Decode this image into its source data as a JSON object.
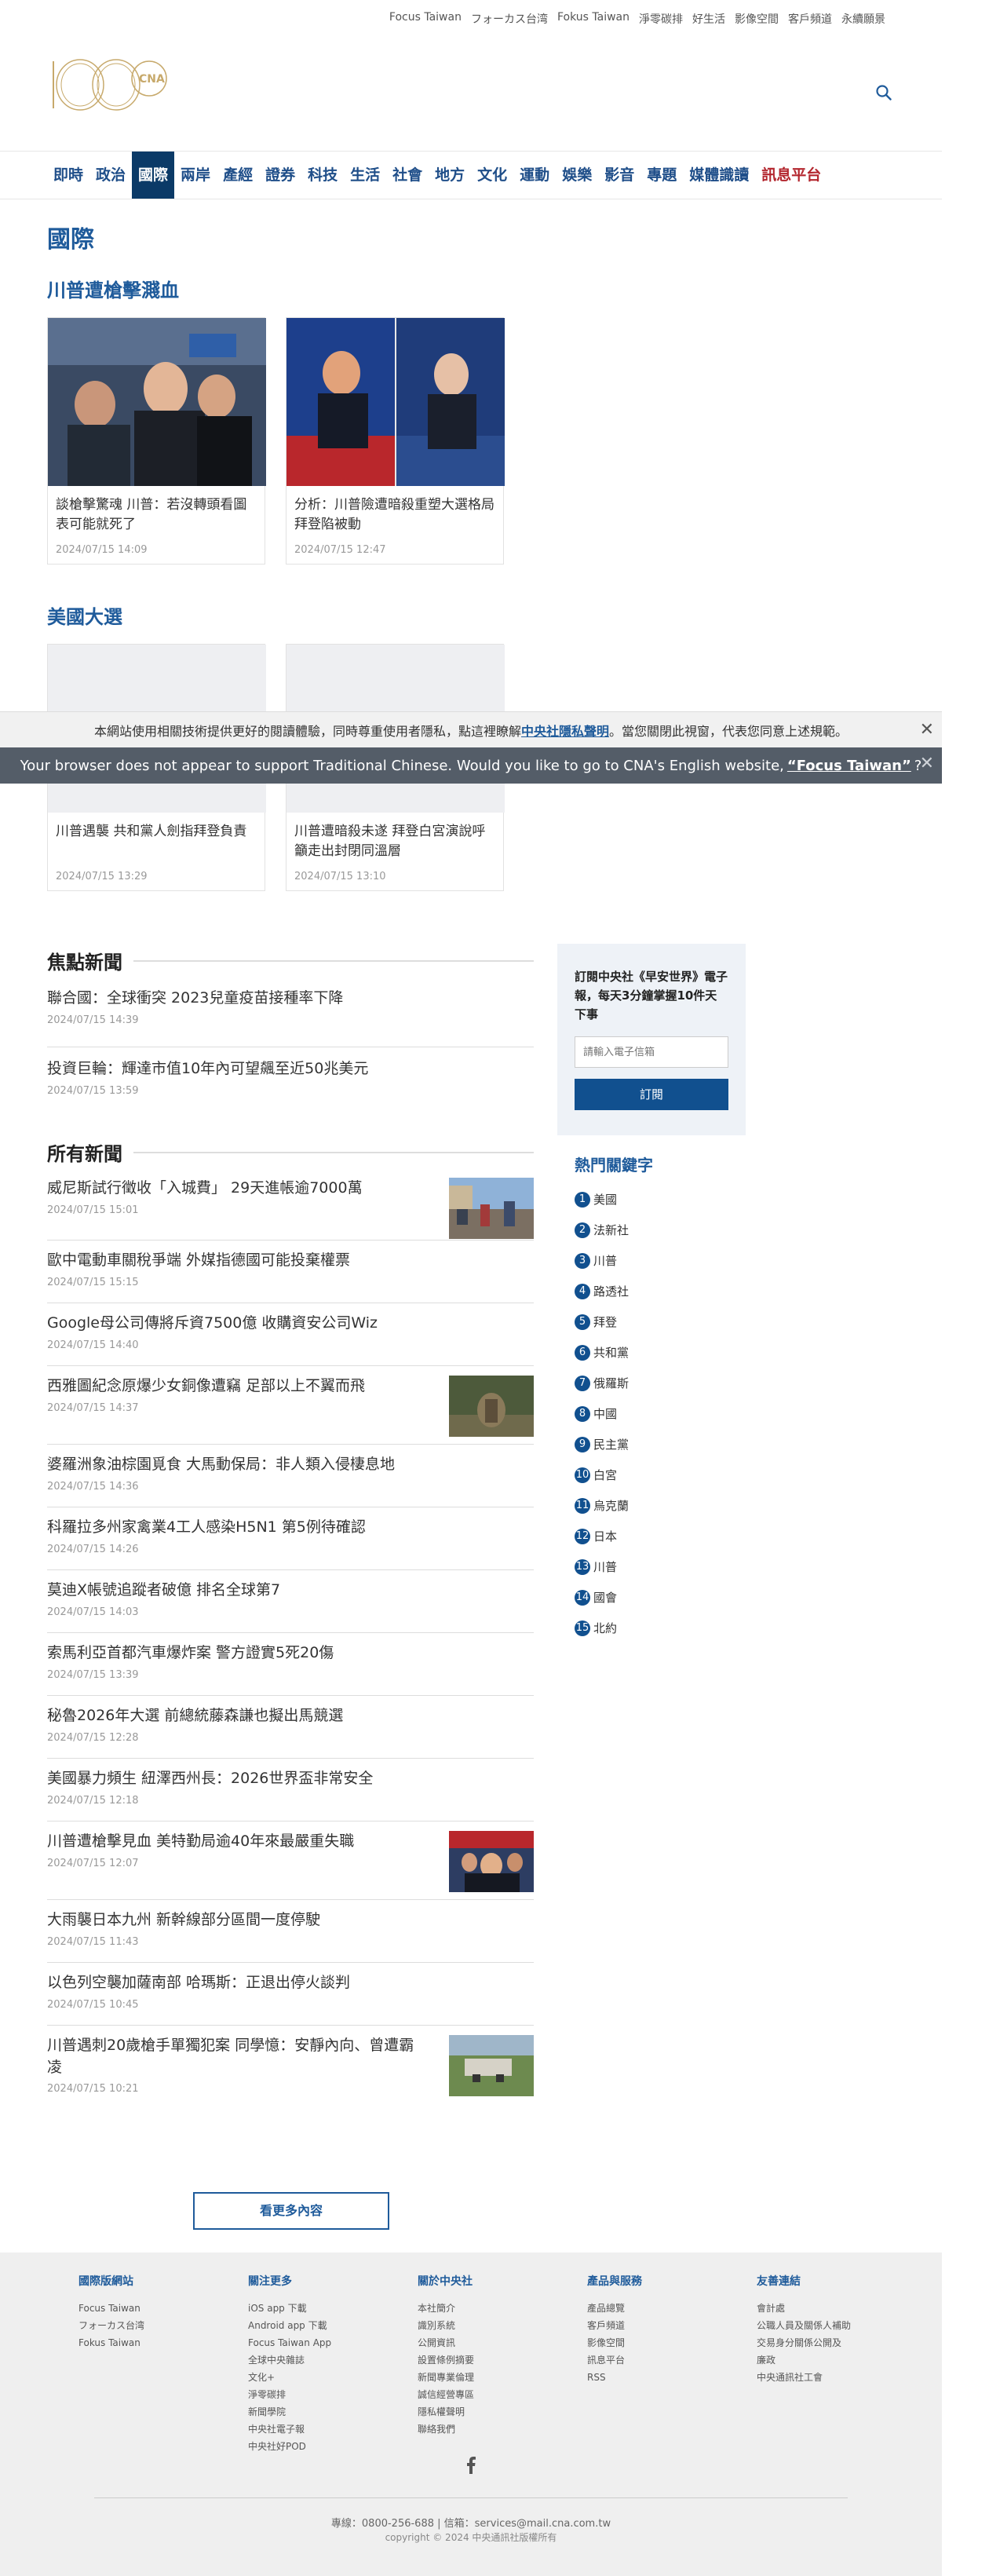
{
  "utility_links": [
    "Focus Taiwan",
    "フォーカス台湾",
    "Fokus Taiwan",
    "淨零碳排",
    "好生活",
    "影像空間",
    "客戶頻道",
    "永續願景"
  ],
  "nav": [
    "即時",
    "政治",
    "國際",
    "兩岸",
    "產經",
    "證券",
    "科技",
    "生活",
    "社會",
    "地方",
    "文化",
    "運動",
    "娛樂",
    "影音",
    "專題",
    "媒體識讀",
    "訊息平台"
  ],
  "page_title": "國際",
  "section1": {
    "title": "川普遭槍擊濺血",
    "cards": [
      {
        "title": "談槍擊驚魂 川普：若沒轉頭看圖表可能就死了",
        "date": "2024/07/15 14:09"
      },
      {
        "title": "分析：川普險遭暗殺重塑大選格局 拜登陷被動",
        "date": "2024/07/15 12:47"
      }
    ]
  },
  "section2": {
    "title": "美國大選",
    "cards": [
      {
        "title": "川普遇襲 共和黨人劍指拜登負責",
        "date": "2024/07/15 13:29"
      },
      {
        "title": "川普遭暗殺未遂 拜登白宮演說呼籲走出封閉同溫層",
        "date": "2024/07/15 13:10"
      }
    ]
  },
  "cookie": {
    "text_before": "本網站使用相關技術提供更好的閱讀體驗，同時尊重使用者隱私，點這裡瞭解",
    "link": "中央社隱私聲明",
    "text_after": "。當您關閉此視窗，代表您同意上述規範。",
    "close": "✕"
  },
  "lang_banner": {
    "text_before": "Your browser does not appear to support Traditional Chinese. Would you like to go to CNA's English website,",
    "link": "“Focus Taiwan”",
    "text_after": "?",
    "close": "✕"
  },
  "focus_news": {
    "title": "焦點新聞",
    "items": [
      {
        "title": "聯合國：全球衝突 2023兒童疫苗接種率下降",
        "date": "2024/07/15 14:39"
      },
      {
        "title": "投資巨輪：輝達市值10年內可望飆至近50兆美元",
        "date": "2024/07/15 13:59"
      }
    ]
  },
  "all_news": {
    "title": "所有新聞",
    "items": [
      {
        "title": "威尼斯試行徵收「入城費」 29天進帳逾7000萬",
        "date": "2024/07/15 15:01",
        "thumb": "crowd-photo"
      },
      {
        "title": "歐中電動車關稅爭端 外媒指德國可能投棄權票",
        "date": "2024/07/15 15:15",
        "thumb": ""
      },
      {
        "title": "Google母公司傳將斥資7500億 收購資安公司Wiz",
        "date": "2024/07/15 14:40",
        "thumb": ""
      },
      {
        "title": "西雅圖紀念原爆少女銅像遭竊 足部以上不翼而飛",
        "date": "2024/07/15 14:37",
        "thumb": "statue-photo"
      },
      {
        "title": "婆羅洲象油棕園覓食 大馬動保局：非人類入侵棲息地",
        "date": "2024/07/15 14:36",
        "thumb": ""
      },
      {
        "title": "科羅拉多州家禽業4工人感染H5N1 第5例待確認",
        "date": "2024/07/15 14:26",
        "thumb": ""
      },
      {
        "title": "莫迪X帳號追蹤者破億 排名全球第7",
        "date": "2024/07/15 14:03",
        "thumb": ""
      },
      {
        "title": "索馬利亞首都汽車爆炸案 警方證實5死20傷",
        "date": "2024/07/15 13:39",
        "thumb": ""
      },
      {
        "title": "秘魯2026年大選 前總統藤森謙也擬出馬競選",
        "date": "2024/07/15 12:28",
        "thumb": ""
      },
      {
        "title": "美國暴力頻生 紐澤西州長：2026世界盃非常安全",
        "date": "2024/07/15 12:18",
        "thumb": ""
      },
      {
        "title": "川普遭槍擊見血 美特勤局逾40年來最嚴重失職",
        "date": "2024/07/15 12:07",
        "thumb": "rally-photo"
      },
      {
        "title": "大雨襲日本九州 新幹線部分區間一度停駛",
        "date": "2024/07/15 11:43",
        "thumb": ""
      },
      {
        "title": "以色列空襲加薩南部 哈瑪斯：正退出停火談判",
        "date": "2024/07/15 10:45",
        "thumb": ""
      },
      {
        "title": "川普遇刺20歲槍手單獨犯案 同學憶：安靜內向、曾遭霸凌",
        "date": "2024/07/15 10:21",
        "thumb": "field-photo"
      }
    ]
  },
  "subscribe": {
    "heading": "訂閱中央社《早安世界》電子報，每天3分鐘掌握10件天下事",
    "placeholder": "請輸入電子信箱",
    "button": "訂閱"
  },
  "hot_keywords": {
    "title": "熱門關鍵字",
    "items": [
      "美國",
      "法新社",
      "川普",
      "路透社",
      "拜登",
      "共和黨",
      "俄羅斯",
      "中國",
      "民主黨",
      "白宮",
      "烏克蘭",
      "日本",
      "川普",
      "國會",
      "北約"
    ]
  },
  "more_button": "看更多內容",
  "footer": {
    "columns": [
      {
        "title": "國際版網站",
        "links": [
          "Focus Taiwan",
          "フォーカス台湾",
          "Fokus Taiwan"
        ]
      },
      {
        "title": "關注更多",
        "links": [
          "iOS app 下載",
          "Android app 下載",
          "Focus Taiwan App",
          "全球中央雜誌",
          "文化+",
          "淨零碳排",
          "新聞學院",
          "中央社電子報",
          "中央社好POD"
        ]
      },
      {
        "title": "關於中央社",
        "links": [
          "本社簡介",
          "識別系統",
          "公開資訊",
          "設置條例摘要",
          "新聞專業倫理",
          "誠信經營專區",
          "隱私權聲明",
          "聯絡我們"
        ]
      },
      {
        "title": "產品與服務",
        "links": [
          "產品總覽",
          "客戶頻道",
          "影像空間",
          "訊息平台",
          "RSS"
        ]
      },
      {
        "title": "友善連結",
        "links": [
          "會計處",
          "公職人員及關係人補助",
          "交易身分關係公開及",
          "廉政",
          "中央通訊社工會"
        ]
      }
    ],
    "contact": "專線：0800-256-688 | 信箱：services@mail.cna.com.tw",
    "copyright": "copyright © 2024 中央通訊社版權所有"
  },
  "colors": {
    "brand": "#1f5b9b",
    "nav_active": "#0b3a67",
    "accent_red": "#b3262e"
  }
}
